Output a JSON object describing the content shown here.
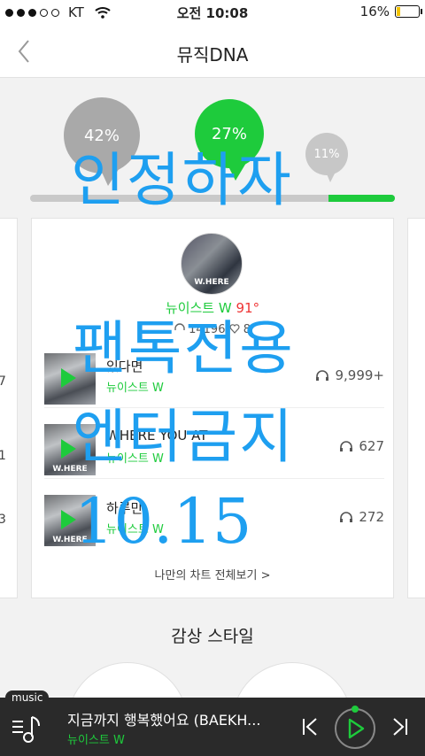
{
  "status_bar": {
    "carrier": "KT",
    "time": "오전 10:08",
    "battery": "16%",
    "battery_level": 0.16,
    "signal_bars": 3
  },
  "nav": {
    "title": "뮤직DNA"
  },
  "distribution": {
    "bubbles": [
      {
        "label": "42%",
        "value": 0.42,
        "color": "#a9a9a9"
      },
      {
        "label": "27%",
        "value": 0.27,
        "color": "#1ecb3c"
      },
      {
        "label": "11%",
        "value": 0.11,
        "color": "#c7c7c7"
      }
    ]
  },
  "side_left": {
    "numbers": [
      "7",
      "1",
      "3"
    ]
  },
  "card": {
    "artist_name": "뉴이스트 W",
    "artist_degree": "91°",
    "plays": "14196",
    "likes": "8",
    "songs": [
      {
        "title": "있다면",
        "artist": "뉴이스트 W",
        "count": "9,999+"
      },
      {
        "title": "WHERE YOU AT",
        "artist": "뉴이스트 W",
        "count": "627"
      },
      {
        "title": "하루만",
        "artist": "뉴이스트 W",
        "count": "272"
      }
    ],
    "see_all": "나만의 차트 전체보기 >"
  },
  "listening_style": {
    "title": "감상 스타일"
  },
  "watermark": {
    "line1": "인정하자",
    "line2": "팬톡전용",
    "line3": "엔터금지",
    "line4": "10.15"
  },
  "player": {
    "tag": "music",
    "title": "지금까지 행복했어요 (BAEKH...",
    "artist": "뉴이스트 W"
  },
  "colors": {
    "accent_green": "#1ecb3c",
    "watermark_blue": "#1e9ff0",
    "player_bg": "#2a2a2a"
  }
}
